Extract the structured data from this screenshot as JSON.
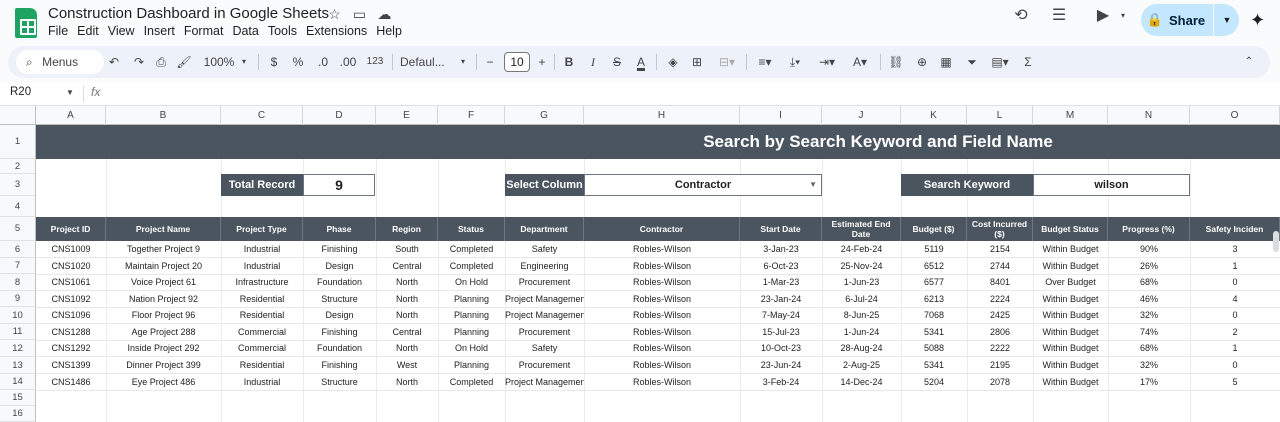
{
  "app": {
    "doc_title": "Construction Dashboard in Google Sheets",
    "menu": [
      "File",
      "Edit",
      "View",
      "Insert",
      "Format",
      "Data",
      "Tools",
      "Extensions",
      "Help"
    ],
    "share_label": "Share"
  },
  "toolbar": {
    "menus_label": "Menus",
    "zoom": "100%",
    "currency": "$",
    "percent": "%",
    "dec_decrease": ".0",
    "dec_increase": ".00",
    "number_format": "123",
    "font": "Defaul...",
    "font_size": "10"
  },
  "formula_bar": {
    "cell_ref": "R20",
    "fx": "fx"
  },
  "columns": [
    "A",
    "B",
    "C",
    "D",
    "E",
    "F",
    "G",
    "H",
    "I",
    "J",
    "K",
    "L",
    "M",
    "N",
    "O"
  ],
  "rows": [
    "1",
    "2",
    "3",
    "4",
    "5",
    "6",
    "7",
    "8",
    "9",
    "10",
    "11",
    "12",
    "13",
    "14",
    "15",
    "16"
  ],
  "sheet": {
    "banner_title": "Search by Search Keyword and Field Name",
    "total_record_label": "Total Record",
    "total_record_value": "9",
    "select_column_label": "Select Column",
    "select_column_value": "Contractor",
    "search_keyword_label": "Search Keyword",
    "search_keyword_value": "wilson"
  },
  "table": {
    "headers": [
      "Project ID",
      "Project Name",
      "Project Type",
      "Phase",
      "Region",
      "Status",
      "Department",
      "Contractor",
      "Start Date",
      "Estimated End Date",
      "Budget ($)",
      "Cost Incurred ($)",
      "Budget Status",
      "Progress (%)",
      "Safety Inciden"
    ],
    "rows": [
      [
        "CNS1009",
        "Together Project 9",
        "Industrial",
        "Finishing",
        "South",
        "Completed",
        "Safety",
        "Robles-Wilson",
        "3-Jan-23",
        "24-Feb-24",
        "5119",
        "2154",
        "Within Budget",
        "90%",
        "3"
      ],
      [
        "CNS1020",
        "Maintain Project 20",
        "Industrial",
        "Design",
        "Central",
        "Completed",
        "Engineering",
        "Robles-Wilson",
        "6-Oct-23",
        "25-Nov-24",
        "6512",
        "2744",
        "Within Budget",
        "26%",
        "1"
      ],
      [
        "CNS1061",
        "Voice Project 61",
        "Infrastructure",
        "Foundation",
        "North",
        "On Hold",
        "Procurement",
        "Robles-Wilson",
        "1-Mar-23",
        "1-Jun-23",
        "6577",
        "8401",
        "Over Budget",
        "68%",
        "0"
      ],
      [
        "CNS1092",
        "Nation Project 92",
        "Residential",
        "Structure",
        "North",
        "Planning",
        "Project Management",
        "Robles-Wilson",
        "23-Jan-24",
        "6-Jul-24",
        "6213",
        "2224",
        "Within Budget",
        "46%",
        "4"
      ],
      [
        "CNS1096",
        "Floor Project 96",
        "Residential",
        "Design",
        "North",
        "Planning",
        "Project Management",
        "Robles-Wilson",
        "7-May-24",
        "8-Jun-25",
        "7068",
        "2425",
        "Within Budget",
        "32%",
        "0"
      ],
      [
        "CNS1288",
        "Age Project 288",
        "Commercial",
        "Finishing",
        "Central",
        "Planning",
        "Procurement",
        "Robles-Wilson",
        "15-Jul-23",
        "1-Jun-24",
        "5341",
        "2806",
        "Within Budget",
        "74%",
        "2"
      ],
      [
        "CNS1292",
        "Inside Project 292",
        "Commercial",
        "Foundation",
        "North",
        "On Hold",
        "Safety",
        "Robles-Wilson",
        "10-Oct-23",
        "28-Aug-24",
        "5088",
        "2222",
        "Within Budget",
        "68%",
        "1"
      ],
      [
        "CNS1399",
        "Dinner Project 399",
        "Residential",
        "Finishing",
        "West",
        "Planning",
        "Procurement",
        "Robles-Wilson",
        "23-Jun-24",
        "2-Aug-25",
        "5341",
        "2195",
        "Within Budget",
        "32%",
        "0"
      ],
      [
        "CNS1486",
        "Eye Project 486",
        "Industrial",
        "Structure",
        "North",
        "Completed",
        "Project Management",
        "Robles-Wilson",
        "3-Feb-24",
        "14-Dec-24",
        "5204",
        "2078",
        "Within Budget",
        "17%",
        "5"
      ]
    ]
  }
}
